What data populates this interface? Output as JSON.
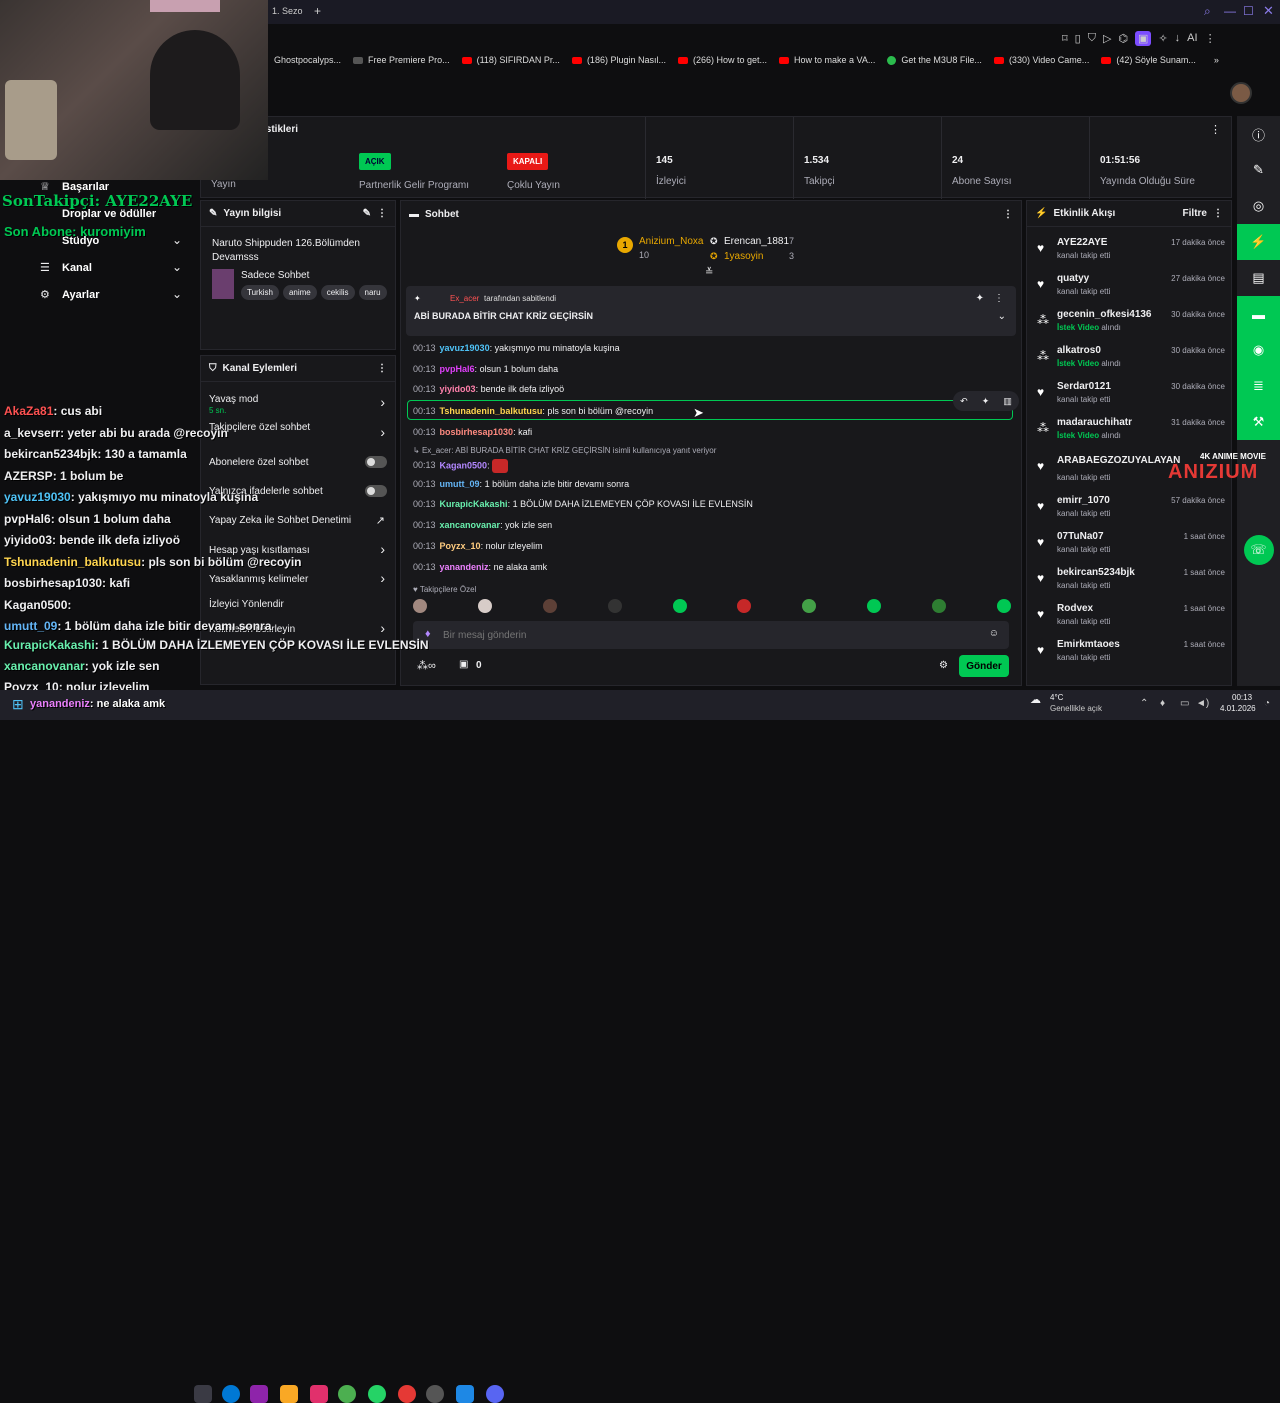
{
  "browser": {
    "tab_title": "1. Sezo",
    "bookmarks": [
      "Ghostpocalyps...",
      "Free Premiere Pro...",
      "(118) SIFIRDAN Pr...",
      "(186) Plugin Nasıl...",
      "(266) How to get...",
      "How to make a VA...",
      "Get the M3U8 File...",
      "(330) Video Came...",
      "(42) Söyle Sunam..."
    ],
    "ai_label": "AI"
  },
  "stats": {
    "title": "istikleri",
    "items": [
      {
        "value": "",
        "label": "Yayın"
      },
      {
        "badge": "AÇIK",
        "badge_color": "#00c853",
        "label": "Partnerlik Gelir Programı"
      },
      {
        "badge": "KAPALI",
        "badge_color": "#e91916",
        "label": "Çoklu Yayın"
      },
      {
        "value": "145",
        "label": "İzleyici"
      },
      {
        "value": "1.534",
        "label": "Takipçi"
      },
      {
        "value": "24",
        "label": "Abone Sayısı"
      },
      {
        "value": "01:51:56",
        "label": "Yayında Olduğu Süre"
      }
    ]
  },
  "nav": {
    "items": [
      "Başarılar",
      "Droplar ve ödüller",
      "Stüdyo",
      "Kanal",
      "Ayarlar"
    ]
  },
  "overlay": {
    "last_follower": "SonTakipçi: AYE22AYE",
    "last_sub": "Son Abone: kuromiyim"
  },
  "stream_info": {
    "title": "Yayın bilgisi",
    "stream_title": "Naruto Shippuden 126.Bölümden Devamsss",
    "category": "Sadece Sohbet",
    "tags": [
      "Turkish",
      "anime",
      "cekilis",
      "naru"
    ]
  },
  "channel_actions": {
    "title": "Kanal Eylemleri",
    "items": [
      {
        "label": "Yavaş mod",
        "sub": "5 sn."
      },
      {
        "label": "Takipçilere özel sohbet"
      },
      {
        "label": "Abonelere özel sohbet"
      },
      {
        "label": "Yalnızca ifadelerle sohbet"
      },
      {
        "label": "Yapay Zeka ile Sohbet Denetimi"
      },
      {
        "label": "Hesap yaşı kısıtlaması"
      },
      {
        "label": "Yasaklanmış kelimeler"
      },
      {
        "label": "İzleyici Yönlendir"
      },
      {
        "label": "Kelimeleri belirleyin"
      }
    ]
  },
  "chat": {
    "title": "Sohbet",
    "top_gifters": [
      {
        "rank": "1",
        "name": "Anizium_Noxa",
        "count": "10"
      },
      {
        "name": "Erencan_1881",
        "count": "7"
      },
      {
        "name": "1yasoyin",
        "count": "3"
      }
    ],
    "pinned_by_user": "Ex_acer",
    "pinned_by_suffix": "tarafından sabitlendi",
    "pinned_text": "ABİ BURADA BİTİR CHAT KRİZ GEÇİRSİN",
    "reply_context": "Ex_acer: ABİ BURADA BİTİR CHAT KRİZ GEÇİRSİN isimli kullanıcıya yanıt veriyor",
    "messages": [
      {
        "time": "00:13",
        "user": "yavuz19030",
        "color": "#4fc3f7",
        "text": "yakışmıyo mu minatoyla kuşina"
      },
      {
        "time": "00:13",
        "user": "pvpHal6",
        "color": "#e040fb",
        "text": "olsun 1 bolum daha"
      },
      {
        "time": "00:13",
        "user": "yiyido03",
        "color": "#ff80ab",
        "text": "bende ilk defa izliyoö"
      },
      {
        "time": "00:13",
        "user": "Tshunadenin_balkutusu",
        "color": "#ffd54f",
        "text": "pls son bi bölüm @recoyin"
      },
      {
        "time": "00:13",
        "user": "bosbirhesap1030",
        "color": "#ff8a80",
        "text": "kafi"
      },
      {
        "time": "00:13",
        "user": "Kagan0500",
        "color": "#b388ff",
        "text": ""
      },
      {
        "time": "00:13",
        "user": "umutt_09",
        "color": "#64b5f6",
        "text": "1 bölüm daha izle bitir devamı sonra"
      },
      {
        "time": "00:13",
        "user": "KurapicKakashi",
        "color": "#69f0ae",
        "text": "1 BÖLÜM DAHA İZLEMEYEN ÇÖP KOVASI İLE EVLENSİN"
      },
      {
        "time": "00:13",
        "user": "xancanovanar",
        "color": "#69f0ae",
        "text": "yok izle sen"
      },
      {
        "time": "00:13",
        "user": "Poyzx_10",
        "color": "#ffcc80",
        "text": "nolur izleyelim"
      },
      {
        "time": "00:13",
        "user": "yanandeniz",
        "color": "#ea80fc",
        "text": "ne alaka amk"
      }
    ],
    "followers_only_label": "Takipçilere Özel",
    "input_placeholder": "Bir mesaj gönderin",
    "points": "0",
    "send_label": "Gönder"
  },
  "activity": {
    "title": "Etkinlik Akışı",
    "filter_label": "Filtre",
    "items": [
      {
        "name": "AYE22AYE",
        "sub": "kanalı takip etti",
        "time": "17 dakika önce"
      },
      {
        "name": "quatyy",
        "sub": "kanalı takip etti",
        "time": "27 dakika önce"
      },
      {
        "name": "gecenin_ofkesi4136",
        "sub_hl": "İstek Video",
        "sub": "alındı",
        "time": "30 dakika önce"
      },
      {
        "name": "alkatros0",
        "sub_hl": "İstek Video",
        "sub": "alındı",
        "time": "30 dakika önce"
      },
      {
        "name": "Serdar0121",
        "sub": "kanalı takip etti",
        "time": "30 dakika önce"
      },
      {
        "name": "madarauchihatr",
        "sub_hl": "İstek Video",
        "sub": "alındı",
        "time": "31 dakika önce"
      },
      {
        "name": "ARABAEGZOZUYALAYAN",
        "sub": "kanalı takip etti",
        "time": ""
      },
      {
        "name": "emirr_1070",
        "sub": "kanalı takip etti",
        "time": "57 dakika önce"
      },
      {
        "name": "07TuNa07",
        "sub": "kanalı takip etti",
        "time": "1 saat önce"
      },
      {
        "name": "bekircan5234bjk",
        "sub": "kanalı takip etti",
        "time": "1 saat önce"
      },
      {
        "name": "Rodvex",
        "sub": "kanalı takip etti",
        "time": "1 saat önce"
      },
      {
        "name": "Emirkmtaoes",
        "sub": "kanalı takip etti",
        "time": "1 saat önce"
      }
    ]
  },
  "watermark": {
    "line1": "4K ANIME MOVIE",
    "line2": "ANIZIUM"
  },
  "overlay_chat": [
    {
      "user": "AkaZa81",
      "color": "#ff5252",
      "text": ": cus abi"
    },
    {
      "user": "a_kevserr",
      "color": "#ffffff",
      "text": ": yeter abi bu arada @recoyin"
    },
    {
      "user": "bekircan5234bjk",
      "color": "#ffffff",
      "text": ": 130 a tamamla"
    },
    {
      "user": "AZERSP",
      "color": "#ffffff",
      "text": ": 1 bolum be"
    },
    {
      "user": "yavuz19030",
      "color": "#4fc3f7",
      "text": ": yakışmıyo mu minatoyla kuşina"
    },
    {
      "user": "pvpHal6",
      "color": "#ffffff",
      "text": ": olsun 1 bolum daha"
    },
    {
      "user": "yiyido03",
      "color": "#ffffff",
      "text": ": bende ilk defa izliyoö"
    },
    {
      "user": "Tshunadenin_balkutusu",
      "color": "#ffd54f",
      "text": ": pls son bi bölüm @recoyin"
    },
    {
      "user": "bosbirhesap1030",
      "color": "#ffffff",
      "text": ": kafi"
    },
    {
      "user": "Kagan0500",
      "color": "#ffffff",
      "text": ":"
    },
    {
      "user": "umutt_09",
      "color": "#64b5f6",
      "text": ": 1 bölüm daha izle bitir devamı sonra"
    },
    {
      "user": "KurapicKakashi",
      "color": "#69f0ae",
      "text": ": 1 BÖLÜM DAHA İZLEMEYEN ÇÖP KOVASI İLE EVLENSİN"
    },
    {
      "user": "xancanovanar",
      "color": "#69f0ae",
      "text": ": yok izle sen"
    },
    {
      "user": "Poyzx_10",
      "color": "#ffffff",
      "text": ": nolur izleyelim"
    },
    {
      "user": "yanandeniz",
      "color": "#ea80fc",
      "text": ": ne alaka amk"
    }
  ],
  "taskbar": {
    "weather_temp": "4°C",
    "weather_desc": "Genellikle açık",
    "time": "00:13",
    "date": "4.01.2026"
  }
}
